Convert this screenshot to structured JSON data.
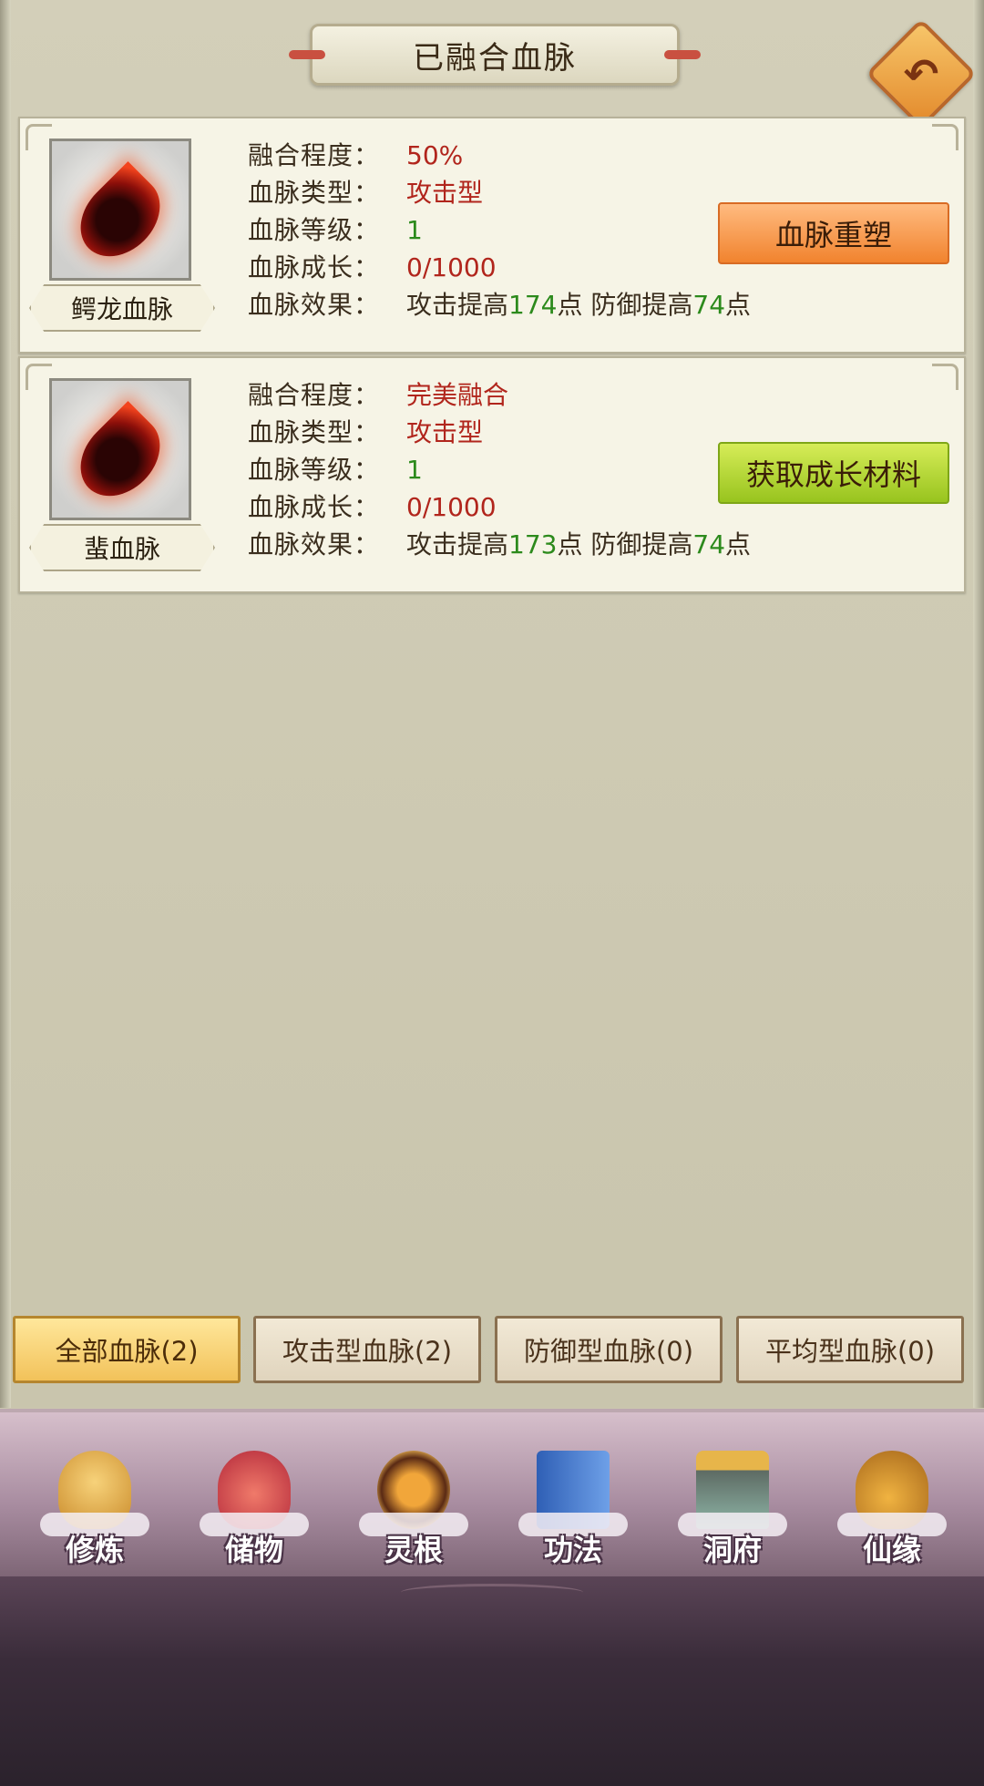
{
  "header": {
    "title": "已融合血脉",
    "back_icon": "back-arrow-icon"
  },
  "cards": [
    {
      "name": "鳄龙血脉",
      "rows": [
        {
          "label": "融合程度：",
          "value": "50%"
        },
        {
          "label": "血脉类型：",
          "value": "攻击型"
        },
        {
          "label": "血脉等级：",
          "value": "1"
        },
        {
          "label": "血脉成长：",
          "value": "0/1000"
        }
      ],
      "effect_label": "血脉效果：",
      "effect": {
        "p1": "攻击提高",
        "n1": "174",
        "p2": "点 防御提高",
        "n2": "74",
        "p3": "点"
      },
      "button": "血脉重塑"
    },
    {
      "name": "蜚血脉",
      "rows": [
        {
          "label": "融合程度：",
          "value": "完美融合"
        },
        {
          "label": "血脉类型：",
          "value": "攻击型"
        },
        {
          "label": "血脉等级：",
          "value": "1"
        },
        {
          "label": "血脉成长：",
          "value": "0/1000"
        }
      ],
      "effect_label": "血脉效果：",
      "effect": {
        "p1": "攻击提高",
        "n1": "173",
        "p2": "点 防御提高",
        "n2": "74",
        "p3": "点"
      },
      "button": "获取成长材料"
    }
  ],
  "tabs": [
    "全部血脉(2)",
    "攻击型血脉(2)",
    "防御型血脉(0)",
    "平均型血脉(0)"
  ],
  "active_tab": 0,
  "nav": [
    {
      "label": "修炼",
      "icon": "cultivate-icon"
    },
    {
      "label": "储物",
      "icon": "storage-bag-icon"
    },
    {
      "label": "灵根",
      "icon": "spirit-root-icon"
    },
    {
      "label": "功法",
      "icon": "technique-book-icon"
    },
    {
      "label": "洞府",
      "icon": "cave-palace-icon"
    },
    {
      "label": "仙缘",
      "icon": "immortal-fate-icon"
    }
  ],
  "colors": {
    "value_red": "#b1251c",
    "number_green": "#2c8a1c",
    "active_tab": "#f2c25a"
  }
}
